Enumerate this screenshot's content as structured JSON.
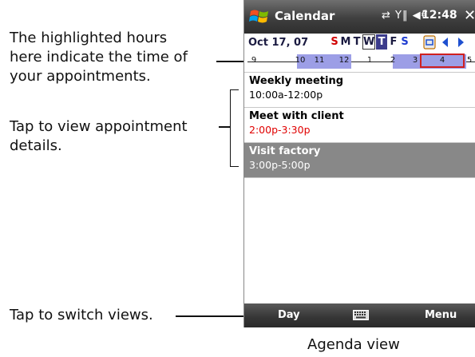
{
  "callouts": {
    "highlighted_hours": [
      "The highlighted hours",
      "here indicate the time of",
      "your appointments."
    ],
    "tap_details": [
      "Tap to view appointment",
      "details."
    ],
    "switch_views": "Tap to switch views."
  },
  "caption": "Agenda view",
  "titlebar": {
    "app_title": "Calendar",
    "status_glyphs": "⇄ Y‖ ◀€",
    "time": "12:48",
    "close": "✕"
  },
  "datebar": {
    "date": "Oct 17, 07",
    "weekdays": [
      "S",
      "M",
      "T",
      "W",
      "T",
      "F",
      "S"
    ]
  },
  "timeline": {
    "hours": [
      "9",
      "10",
      "11",
      "12",
      "1",
      "2",
      "3",
      "4",
      "5"
    ]
  },
  "appointments": [
    {
      "subject": "Weekly meeting",
      "time": "10:00a-12:00p",
      "conflict": false
    },
    {
      "subject": "Meet with client",
      "time": "2:00p-3:30p",
      "conflict": true
    },
    {
      "subject": "Visit factory",
      "time": "3:00p-5:00p",
      "conflict": false
    }
  ],
  "softkeys": {
    "left": "Day",
    "right": "Menu"
  },
  "colors": {
    "highlight": "#9c9ee6",
    "selected_day": "#3c3c8c",
    "conflict": "#e00000",
    "now_box": "#d02020"
  }
}
